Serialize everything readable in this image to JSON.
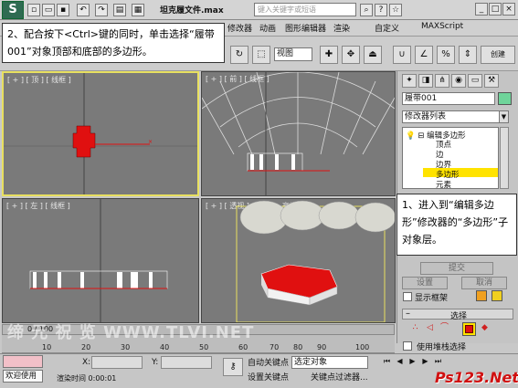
{
  "titlebar": {
    "title": "坦克履文件.max",
    "search_placeholder": "键入关键字或短语"
  },
  "menubar": {
    "items": [
      "修改器",
      "动画",
      "图形编辑器",
      "渲染",
      "自定义",
      "MAXScript"
    ]
  },
  "toolbar": {
    "view_select": "视图",
    "create_label": "创建"
  },
  "callouts": {
    "step2": "2、配合按下<Ctrl>键的同时，单击选择“履带 001”对象顶部和底部的多边形。",
    "step1": "1、进入到“编辑多边形”修改器的“多边形”子对象层。"
  },
  "viewports": {
    "top": "[ + ] [ 顶 ] [ 线框 ]",
    "front": "[ + ] [ 前 ] [ 线框 ]",
    "left": "[ + ] [ 左 ] [ 线框 ]",
    "persp": "[ + ] [ 透视 ] [ 平滑 + 高光 ]"
  },
  "command_panel": {
    "object_name": "履带001",
    "modifier_list": "修改器列表",
    "stack": {
      "root": "编辑多边形",
      "items": [
        "顶点",
        "边",
        "边界",
        "多边形",
        "元素"
      ],
      "selected": "多边形"
    },
    "submit": "提交",
    "settings": "设置",
    "cancel": "取消",
    "show_cage": "显示框架",
    "selection_title": "选择",
    "use_stack": "使用堆栈选择"
  },
  "timeline": {
    "frame": "0 / 100",
    "ticks": [
      "10",
      "20",
      "30",
      "40",
      "50",
      "60",
      "70",
      "80",
      "90",
      "100"
    ]
  },
  "statusbar": {
    "welcome": "欢迎使用",
    "render_time": "渲染时间  0:00:01",
    "x_label": "X:",
    "y_label": "Y:",
    "auto_key": "自动关键点",
    "set_key": "设置关键点",
    "selected_object": "选定对象",
    "key_filters": "关键点过滤器..."
  },
  "watermarks": {
    "site1": "缔 元 祝 览 WWW.TLVI.NET",
    "site2": "Ps123.Net"
  }
}
